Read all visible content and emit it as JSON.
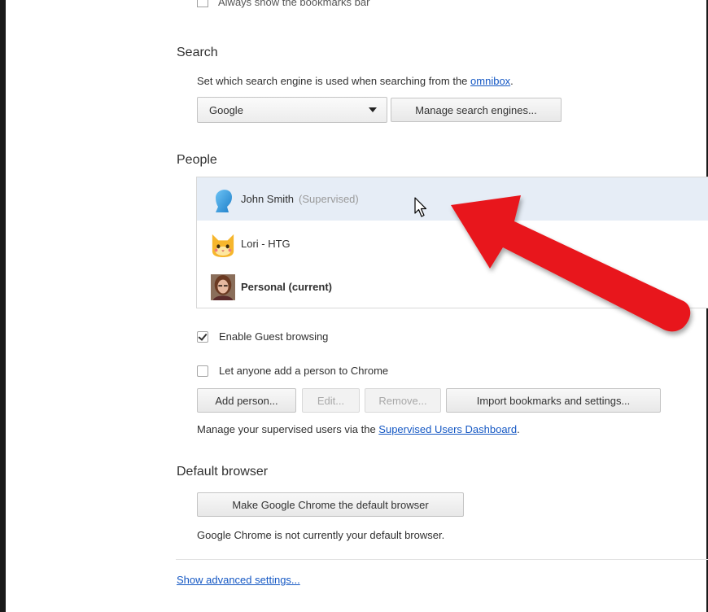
{
  "cutoff": {
    "label": "Always show the bookmarks bar"
  },
  "search": {
    "title": "Search",
    "description_prefix": "Set which search engine is used when searching from the ",
    "omnibox_link": "omnibox",
    "description_suffix": ".",
    "engine_selected": "Google",
    "manage_button": "Manage search engines..."
  },
  "people": {
    "title": "People",
    "list": [
      {
        "name": "John Smith",
        "tag": "(Supervised)",
        "avatar": "blue-person-avatar"
      },
      {
        "name": "Lori - HTG",
        "tag": "",
        "avatar": "cat-avatar"
      },
      {
        "name": "Personal (current)",
        "tag": "",
        "avatar": "photo-avatar"
      }
    ],
    "enable_guest": "Enable Guest browsing",
    "let_anyone": "Let anyone add a person to Chrome",
    "add_person": "Add person...",
    "edit": "Edit...",
    "remove": "Remove...",
    "import": "Import bookmarks and settings...",
    "supervised_prefix": "Manage your supervised users via the ",
    "supervised_link": "Supervised Users Dashboard",
    "supervised_suffix": "."
  },
  "default_browser": {
    "title": "Default browser",
    "button": "Make Google Chrome the default browser",
    "status": "Google Chrome is not currently your default browser."
  },
  "advanced": {
    "link": "Show advanced settings..."
  },
  "colors": {
    "arrow": "#e8151b",
    "link": "#1558c4",
    "selected_row": "#e6edf6"
  }
}
